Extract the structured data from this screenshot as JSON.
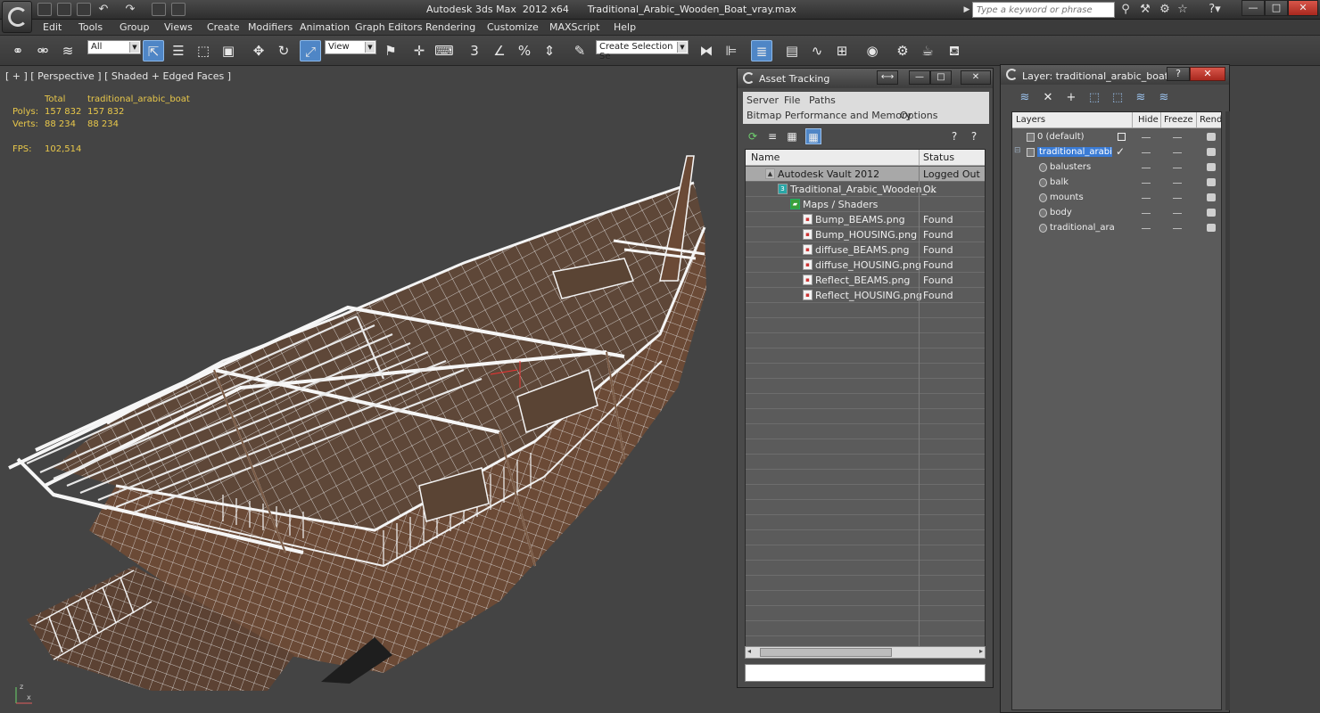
{
  "titlebar": {
    "title": "Autodesk 3ds Max  2012 x64      Traditional_Arabic_Wooden_Boat_vray.max",
    "search_placeholder": "Type a keyword or phrase"
  },
  "menubar": [
    "Edit",
    "Tools",
    "Group",
    "Views",
    "Create",
    "Modifiers",
    "Animation",
    "Graph Editors",
    "Rendering",
    "Customize",
    "MAXScript",
    "Help"
  ],
  "toolbar": {
    "selection_filter": "All",
    "reference_coord": "View",
    "selection_set": "Create Selection Se"
  },
  "viewport": {
    "label": "[ + ] [ Perspective ] [ Shaded + Edged Faces ]",
    "stats": {
      "total_label": "Total",
      "object_label": "traditional_arabic_boat",
      "polys_label": "Polys:",
      "polys_total": "157 832",
      "polys_object": "157 832",
      "verts_label": "Verts:",
      "verts_total": "88 234",
      "verts_object": "88 234",
      "fps_label": "FPS:",
      "fps_value": "102,514"
    },
    "axis": {
      "x": "x",
      "z": "z"
    }
  },
  "asset_tracking": {
    "title": "Asset Tracking",
    "menu": [
      "Server",
      "File",
      "Paths",
      "Bitmap Performance and Memory",
      "Options"
    ],
    "columns": {
      "name": "Name",
      "status": "Status"
    },
    "rows": [
      {
        "name": "Autodesk Vault 2012",
        "status": "Logged Out ..."
      },
      {
        "name": "Traditional_Arabic_Wooden_...",
        "status": "Ok"
      },
      {
        "name": "Maps / Shaders",
        "status": ""
      },
      {
        "name": "Bump_BEAMS.png",
        "status": "Found"
      },
      {
        "name": "Bump_HOUSING.png",
        "status": "Found"
      },
      {
        "name": "diffuse_BEAMS.png",
        "status": "Found"
      },
      {
        "name": "diffuse_HOUSING.png",
        "status": "Found"
      },
      {
        "name": "Reflect_BEAMS.png",
        "status": "Found"
      },
      {
        "name": "Reflect_HOUSING.png",
        "status": "Found"
      }
    ]
  },
  "layer_manager": {
    "title": "Layer: traditional_arabic_boat",
    "columns": {
      "layers": "Layers",
      "hide": "Hide",
      "freeze": "Freeze",
      "render": "Rende"
    },
    "rows": [
      {
        "name": "0 (default)"
      },
      {
        "name": "traditional_arabic_b"
      },
      {
        "name": "balusters"
      },
      {
        "name": "balk"
      },
      {
        "name": "mounts"
      },
      {
        "name": "body"
      },
      {
        "name": "traditional_arabi"
      }
    ]
  }
}
